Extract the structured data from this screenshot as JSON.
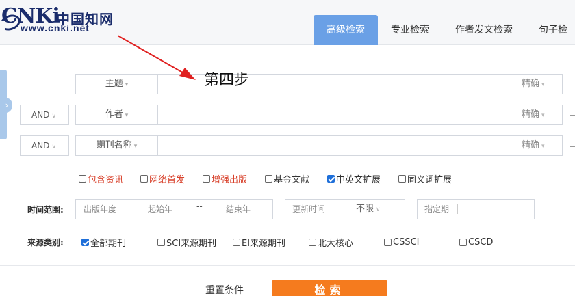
{
  "header": {
    "logo_cnki": "CNKi",
    "logo_cn": "中国知网",
    "logo_url": "www.cnki.net",
    "tabs": [
      "高级检索",
      "专业检索",
      "作者发文检索",
      "句子检"
    ]
  },
  "annotation": {
    "text": "第四步",
    "color": "#e02020"
  },
  "search_rows": [
    {
      "logic": "",
      "field": "主题",
      "exact": "精确"
    },
    {
      "logic": "AND",
      "field": "作者",
      "exact": "精确"
    },
    {
      "logic": "AND",
      "field": "期刊名称",
      "exact": "精确"
    }
  ],
  "options": [
    {
      "label": "包含资讯",
      "checked": false,
      "color": "red"
    },
    {
      "label": "网络首发",
      "checked": false,
      "color": "red"
    },
    {
      "label": "增强出版",
      "checked": false,
      "color": "red"
    },
    {
      "label": "基金文献",
      "checked": false,
      "color": "dark"
    },
    {
      "label": "中英文扩展",
      "checked": true,
      "color": "dark"
    },
    {
      "label": "同义词扩展",
      "checked": false,
      "color": "dark"
    }
  ],
  "time_range": {
    "label": "时间范围:",
    "pub_year_label": "出版年度",
    "start_year": "起始年",
    "range_sep": "--",
    "end_year": "结束年",
    "update_label": "更新时间",
    "update_value": "不限",
    "specified_label": "指定期"
  },
  "source": {
    "label": "来源类别:",
    "items": [
      {
        "label": "全部期刊",
        "checked": true
      },
      {
        "label": "SCI来源期刊",
        "checked": false
      },
      {
        "label": "EI来源期刊",
        "checked": false
      },
      {
        "label": "北大核心",
        "checked": false
      },
      {
        "label": "CSSCI",
        "checked": false
      },
      {
        "label": "CSCD",
        "checked": false
      }
    ]
  },
  "actions": {
    "reset": "重置条件",
    "search": "检索"
  },
  "colors": {
    "accent_tab": "#6aa0e6",
    "search_button": "#f57b1e",
    "checkbox": "#1e6fd9"
  }
}
